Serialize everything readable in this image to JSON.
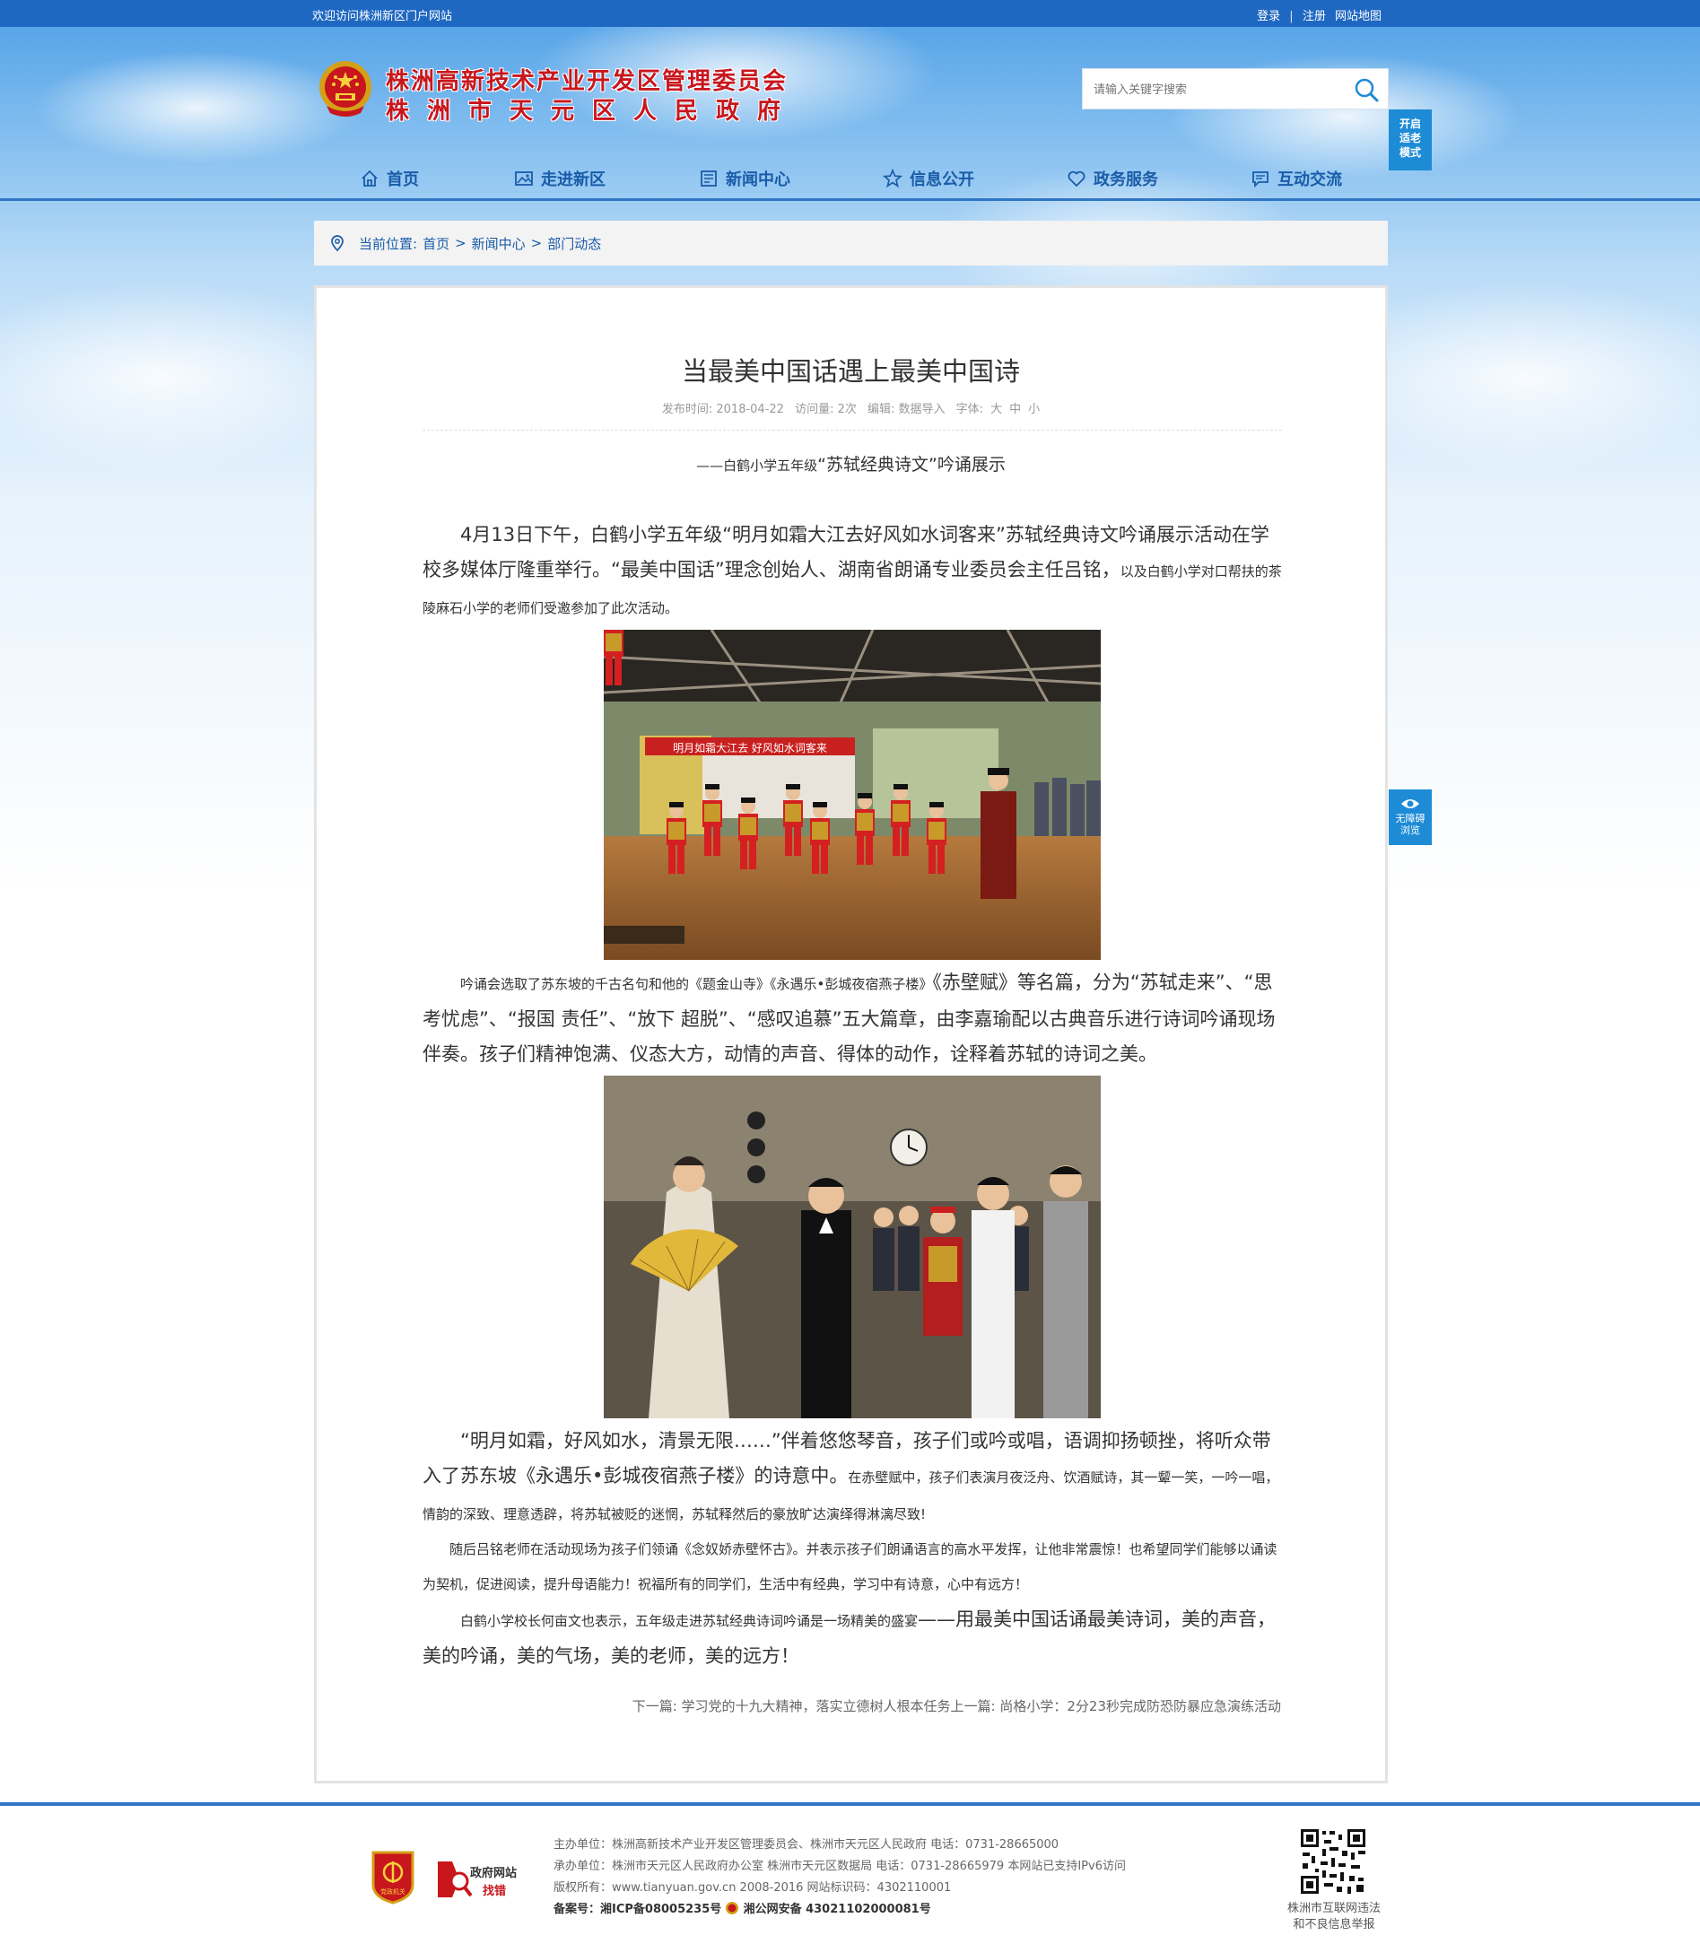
{
  "topbar": {
    "welcome": "欢迎访问株洲新区门户网站",
    "login": "登录",
    "sep": "|",
    "register": "注册",
    "sitemap": "网站地图"
  },
  "header": {
    "title_line1": "株洲高新技术产业开发区管理委员会",
    "title_line2": "株洲市天元区人民政府",
    "search_placeholder": "请输入关键字搜索",
    "elder_mode": [
      "开启",
      "适老",
      "模式"
    ]
  },
  "nav": [
    {
      "label": "首页",
      "icon": "home-icon"
    },
    {
      "label": "走进新区",
      "icon": "picture-icon"
    },
    {
      "label": "新闻中心",
      "icon": "newspaper-icon"
    },
    {
      "label": "信息公开",
      "icon": "star-icon"
    },
    {
      "label": "政务服务",
      "icon": "heart-icon"
    },
    {
      "label": "互动交流",
      "icon": "chat-icon"
    }
  ],
  "breadcrumb": {
    "prefix": "当前位置:",
    "home": "首页",
    "sep": ">",
    "news": "新闻中心",
    "current": "部门动态"
  },
  "article": {
    "title": "当最美中国话遇上最美中国诗",
    "meta": {
      "publish": "发布时间: 2018-04-22",
      "views": "访问量: 2次",
      "editor": "编辑: 数据导入",
      "font_label": "字体:",
      "font_large": "大",
      "font_mid": "中",
      "font_small": "小"
    },
    "subtitle_small": "——白鹤小学五年级",
    "subtitle_main": "“苏轼经典诗文”吟诵展示",
    "p1_large": "4月13日下午，白鹤小学五年级“明月如霜大江去好风如水词客来”苏轼经典诗文吟诵展示活动在学校多媒体厅隆重举行。“最美中国话”理念创始人、湖南省朗诵专业委员会主任吕铭，",
    "p1_small": "以及白鹤小学对口帮扶的茶陵麻石小学的老师们受邀参加了此次活动。",
    "p2_small": "吟诵会选取了苏东坡的千古名句和他的《题金山寺》《永遇乐•彭城夜宿燕子楼》",
    "p2_large": "《赤壁赋》等名篇，分为“苏轼走来”、“思考忧虑”、“报国 责任”、“放下 超脱”、“感叹追慕”五大篇章，由李嘉瑜配以古典音乐进行诗词吟诵现场伴奏。孩子们精神饱满、仪态大方，动情的声音、得体的动作，诠释着苏轼的诗词之美。",
    "p3_large": "“明月如霜，好风如水，清景无限……”伴着悠悠琴音，孩子们或吟或唱，语调抑扬顿挫，将听众带入了苏东坡《永遇乐•彭城夜宿燕子楼》的诗意中。",
    "p3_small": "在赤壁赋中，孩子们表演月夜泛舟、饮酒赋诗，其一颦一笑，一吟一唱，情韵的深致、理意透辟，将苏轼被贬的迷惘，苏轼释然后的豪放旷达演绎得淋漓尽致!",
    "p4": "随后吕铭老师在活动现场为孩子们领诵《念奴娇赤壁怀古》。并表示孩子们朗诵语言的高水平发挥，让他非常震惊！也希望同学们能够以诵读为契机，促进阅读，提升母语能力！祝福所有的同学们，生活中有经典，学习中有诗意，心中有远方！",
    "p5_small": "白鹤小学校长何亩文也表示，五年级走进苏轼经典诗词吟诵是一场精美的盛宴",
    "p5_large": "——用最美中国话诵最美诗词，美的声音，美的吟诵，美的气场，美的老师，美的远方！",
    "banner_text": "明月如霜大江去  好风如水词客来",
    "next_label": "下一篇: ",
    "next_title": "学习党的十九大精神，落实立德树人根本任务",
    "prev_label": "上一篇: ",
    "prev_title": "尚格小学：2分23秒完成防恐防暴应急演练活动"
  },
  "side": {
    "barrier": [
      "无障碍",
      "浏览"
    ]
  },
  "footer": {
    "badge_party": "党政机关",
    "badge_gov_line1": "政府网站",
    "badge_gov_line2": "找错",
    "host": "主办单位：株洲高新技术产业开发区管理委员会、株洲市天元区人民政府 电话：0731-28665000",
    "organizer": "承办单位：株洲市天元区人民政府办公室 株洲市天元区数据局 电话：0731-28665979 本网站已支持IPv6访问",
    "copyright": "版权所有：www.tianyuan.gov.cn 2008-2016 网站标识码：4302110001",
    "icp": "备案号：湘ICP备08005235号",
    "police": "湘公网安备 43021102000081号",
    "qr_caption_1": "株洲市互联网违法",
    "qr_caption_2": "和不良信息举报"
  },
  "colors": {
    "primary": "#1f68c2",
    "title_red": "#c8161d",
    "nav_text": "#1a5ca8",
    "float_blue": "#1e8bd6"
  }
}
